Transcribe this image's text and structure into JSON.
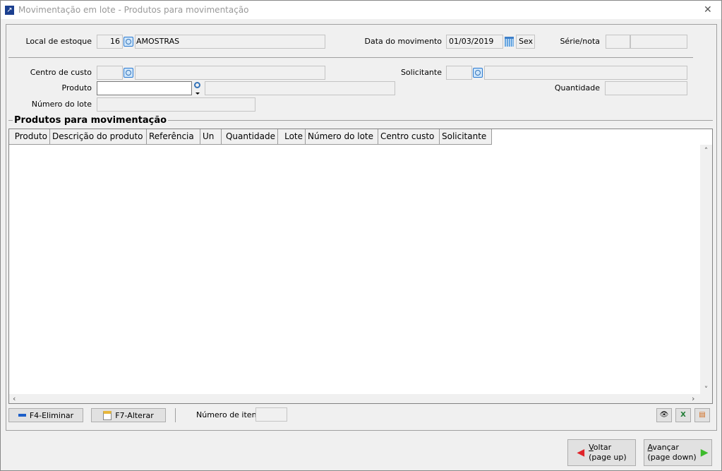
{
  "window": {
    "title": "Movimentação em lote - Produtos para movimentação",
    "close": "✕"
  },
  "form": {
    "local_estoque": {
      "label": "Local de estoque",
      "code": "16",
      "description": "AMOSTRAS"
    },
    "data_movimento": {
      "label": "Data do movimento",
      "value": "01/03/2019",
      "weekday": "Sex"
    },
    "serie_nota": {
      "label": "Série/nota",
      "serie": "",
      "nota": ""
    },
    "centro_custo": {
      "label": "Centro de custo",
      "code": "",
      "description": ""
    },
    "solicitante": {
      "label": "Solicitante",
      "code": "",
      "description": ""
    },
    "produto": {
      "label": "Produto",
      "code": "",
      "description": ""
    },
    "quantidade": {
      "label": "Quantidade",
      "value": ""
    },
    "numero_lote": {
      "label": "Número do lote",
      "value": ""
    }
  },
  "grid": {
    "title": "Produtos para movimentação",
    "columns": [
      "Produto",
      "Descrição do produto",
      "Referência",
      "Un",
      "Quantidade",
      "Lote",
      "Número do lote",
      "Centro custo",
      "Solicitante"
    ],
    "rows": []
  },
  "footer": {
    "eliminar": "F4-Eliminar",
    "alterar": "F7-Alterar",
    "numero_itens_label": "Número de itens",
    "numero_itens": ""
  },
  "nav": {
    "voltar_a": "V",
    "voltar_b": "oltar",
    "voltar_sub": "(page up)",
    "avancar_a": "A",
    "avancar_b": "vançar",
    "avancar_sub": "(page down)"
  }
}
